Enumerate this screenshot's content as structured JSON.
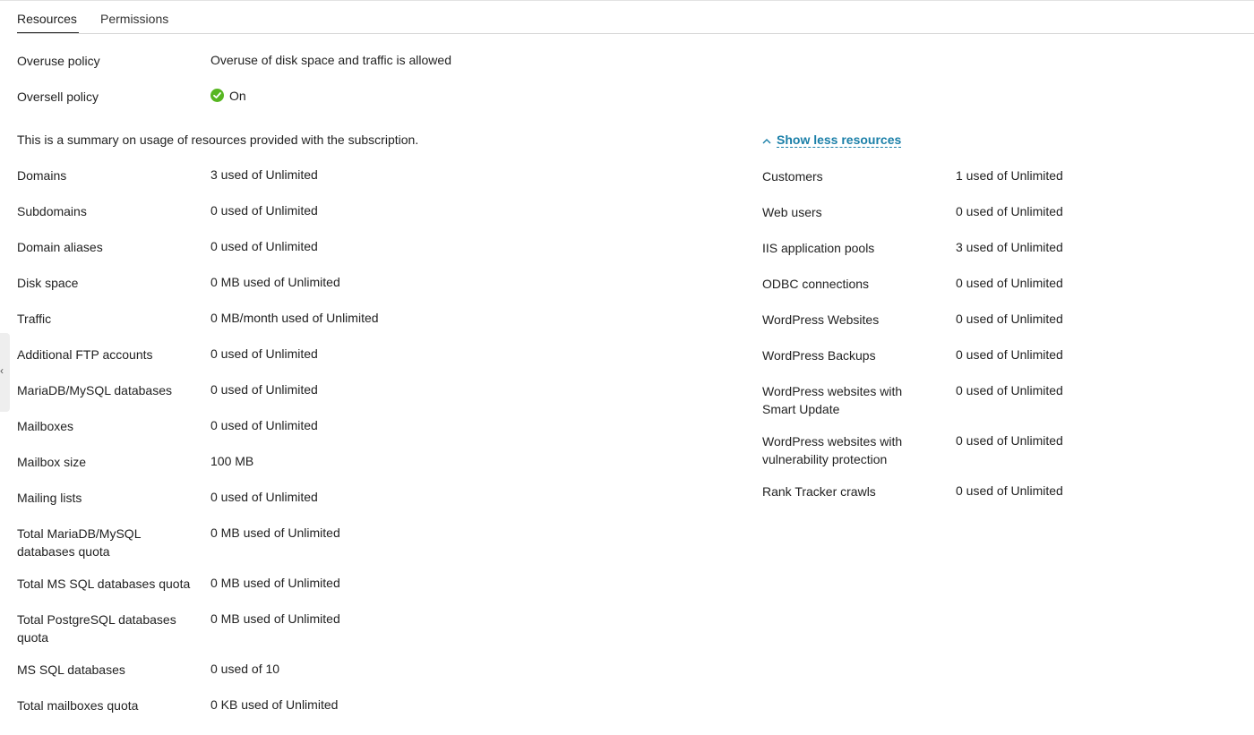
{
  "tabs": {
    "resources": "Resources",
    "permissions": "Permissions"
  },
  "policies": {
    "overuse_label": "Overuse policy",
    "overuse_value": "Overuse of disk space and traffic is allowed",
    "oversell_label": "Oversell policy",
    "oversell_value": "On"
  },
  "summary_text": "This is a summary on usage of resources provided with the subscription.",
  "show_less_label": "Show less resources",
  "left_resources": [
    {
      "label": "Domains",
      "value": "3 used of Unlimited"
    },
    {
      "label": "Subdomains",
      "value": "0 used of Unlimited"
    },
    {
      "label": "Domain aliases",
      "value": "0 used of Unlimited"
    },
    {
      "label": "Disk space",
      "value": "0 MB used of Unlimited"
    },
    {
      "label": "Traffic",
      "value": "0 MB/month used of Unlimited"
    },
    {
      "label": "Additional FTP accounts",
      "value": "0 used of Unlimited"
    },
    {
      "label": "MariaDB/MySQL databases",
      "value": "0 used of Unlimited"
    },
    {
      "label": "Mailboxes",
      "value": "0 used of Unlimited"
    },
    {
      "label": "Mailbox size",
      "value": "100 MB"
    },
    {
      "label": "Mailing lists",
      "value": "0 used of Unlimited"
    },
    {
      "label": "Total MariaDB/MySQL databases quota",
      "label_line1": "Total MariaDB/MySQL",
      "label_line2": "databases quota",
      "value": "0 MB used of Unlimited"
    },
    {
      "label": "Total MS SQL databases quota",
      "value": "0 MB used of Unlimited"
    },
    {
      "label": "Total PostgreSQL databases quota",
      "label_line1": "Total PostgreSQL databases",
      "label_line2": "quota",
      "value": "0 MB used of Unlimited"
    },
    {
      "label": "MS SQL databases",
      "value": "0 used of 10"
    },
    {
      "label": "Total mailboxes quota",
      "value": "0 KB used of Unlimited"
    }
  ],
  "right_resources": [
    {
      "label": "Customers",
      "value": "1 used of Unlimited"
    },
    {
      "label": "Web users",
      "value": "0 used of Unlimited"
    },
    {
      "label": "IIS application pools",
      "value": "3 used of Unlimited"
    },
    {
      "label": "ODBC connections",
      "value": "0 used of Unlimited"
    },
    {
      "label": "WordPress Websites",
      "value": "0 used of Unlimited"
    },
    {
      "label": "WordPress Backups",
      "value": "0 used of Unlimited"
    },
    {
      "label": "WordPress websites with Smart Update",
      "label_line1": "WordPress websites with",
      "label_line2": "Smart Update",
      "value": "0 used of Unlimited"
    },
    {
      "label": "WordPress websites with vulnerability protection",
      "label_line1": "WordPress websites with",
      "label_line2": "vulnerability protection",
      "value": "0 used of Unlimited"
    },
    {
      "label": "Rank Tracker crawls",
      "value": "0 used of Unlimited"
    }
  ],
  "colors": {
    "link": "#1a7fa8",
    "status_on": "#57b621",
    "tab_active_underline": "#222222"
  },
  "icons": {
    "status_on": "check-circle-icon",
    "show_less": "chevron-up-icon",
    "sidebar_toggle": "chevron-left-icon"
  }
}
